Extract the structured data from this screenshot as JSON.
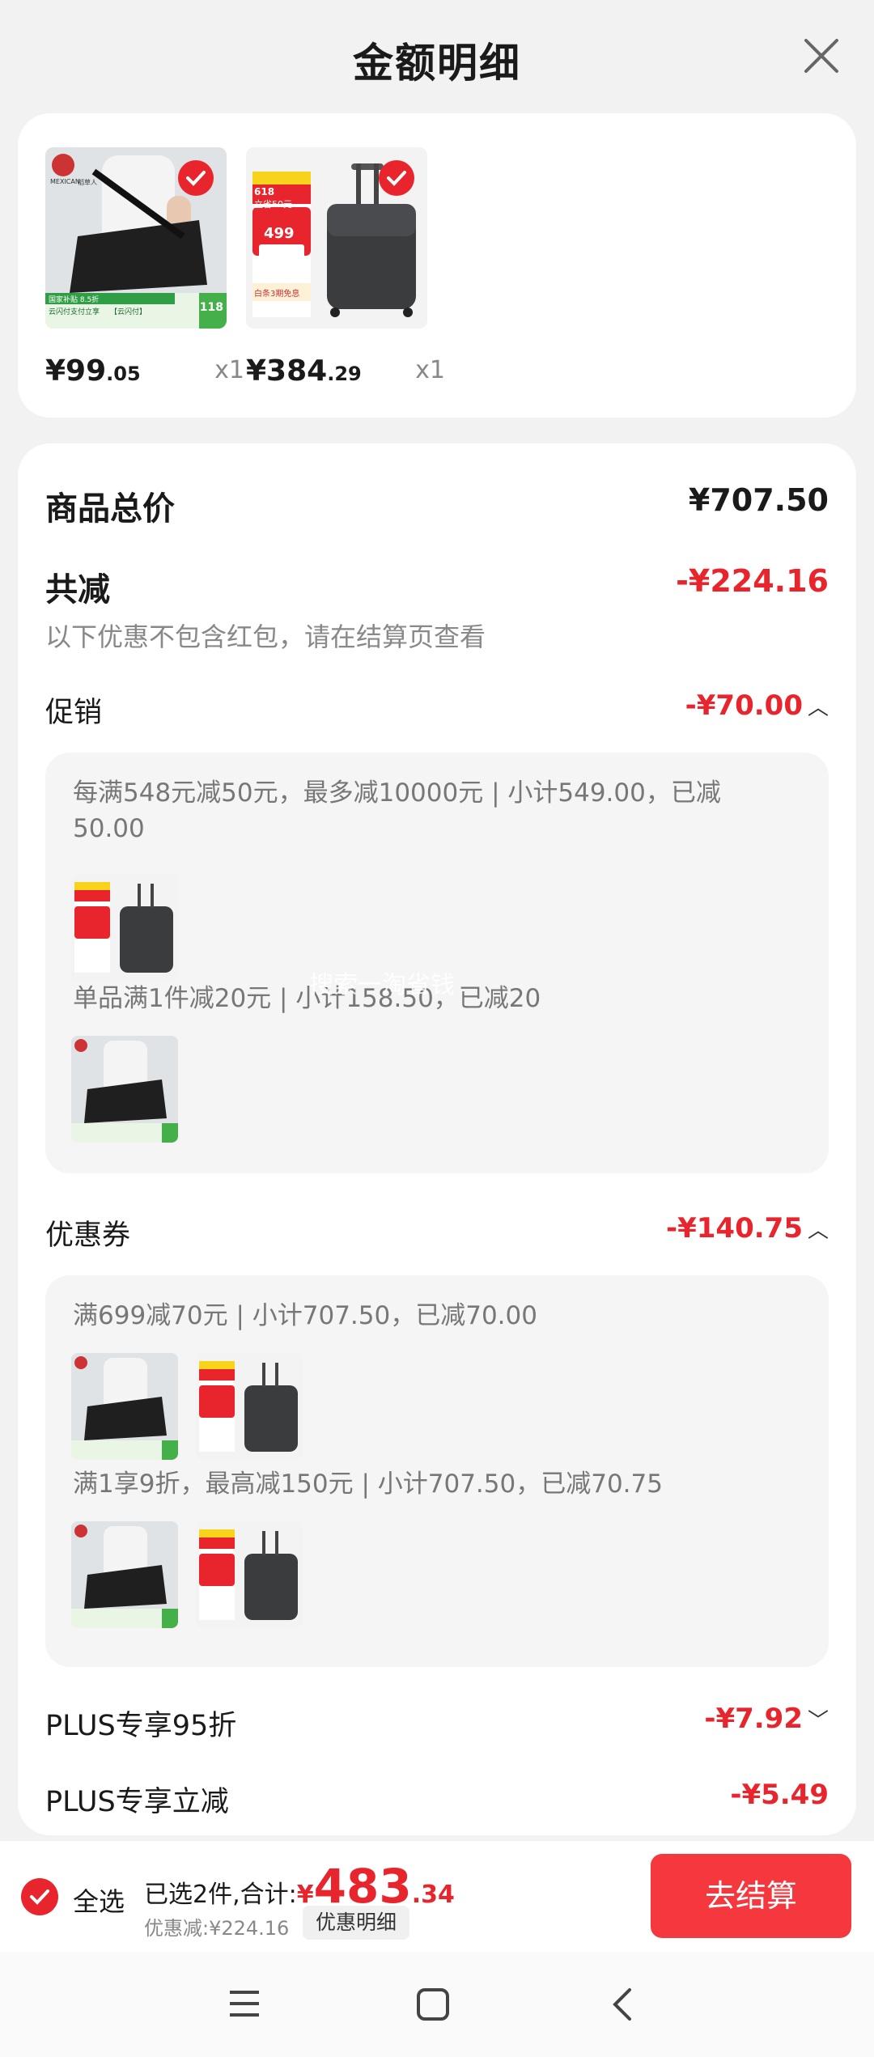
{
  "header": {
    "title": "金额明细"
  },
  "products": [
    {
      "price_int": "¥99",
      "price_dec": ".05",
      "qty": "x1"
    },
    {
      "price_int": "¥384",
      "price_dec": ".29",
      "qty": "x1"
    }
  ],
  "thumb_text": {
    "bag_brand": "MEXICAN",
    "bag_brand_cn": "稻草人",
    "bag_promo1": "国家补贴 8.5折",
    "bag_promo2": "云闪付支付立享",
    "bag_promo3": "【云闪付】",
    "bag_price": "118",
    "suitcase_618": "618",
    "suitcase_promo": "立省50元",
    "suitcase_price": "499",
    "suitcase_free": "白条3期免息"
  },
  "summary": {
    "total_label": "商品总价",
    "total_value": "¥707.50",
    "reduce_label": "共减",
    "reduce_value": "-¥224.16",
    "note": "以下优惠不包含红包，请在结算页查看"
  },
  "promotion": {
    "label": "促销",
    "value": "-¥70.00",
    "rule1": "每满548元减50元，最多减10000元 | 小计549.00，已减50.00",
    "rule2": "单品满1件减20元 | 小计158.50，已减20"
  },
  "coupon": {
    "label": "优惠券",
    "value": "-¥140.75",
    "rule1": "满699减70元 | 小计707.50，已减70.00",
    "rule2": "满1享9折，最高减150元 | 小计707.50，已减70.75"
  },
  "plus_discount": {
    "label": "PLUS专享95折",
    "value": "-¥7.92"
  },
  "plus_instant": {
    "label": "PLUS专享立减",
    "value": "-¥5.49"
  },
  "bottom": {
    "select_all": "全选",
    "selected_text": "已选2件,合计:",
    "total_symbol": "¥",
    "total_int": "483",
    "total_dec": ".34",
    "discount_text": "优惠减:¥224.16",
    "detail_button": "优惠明细",
    "checkout_button": "去结算"
  },
  "watermark": "搜索一淘省钱",
  "colors": {
    "accent": "#e8252c",
    "bg": "#f2f2f2"
  }
}
